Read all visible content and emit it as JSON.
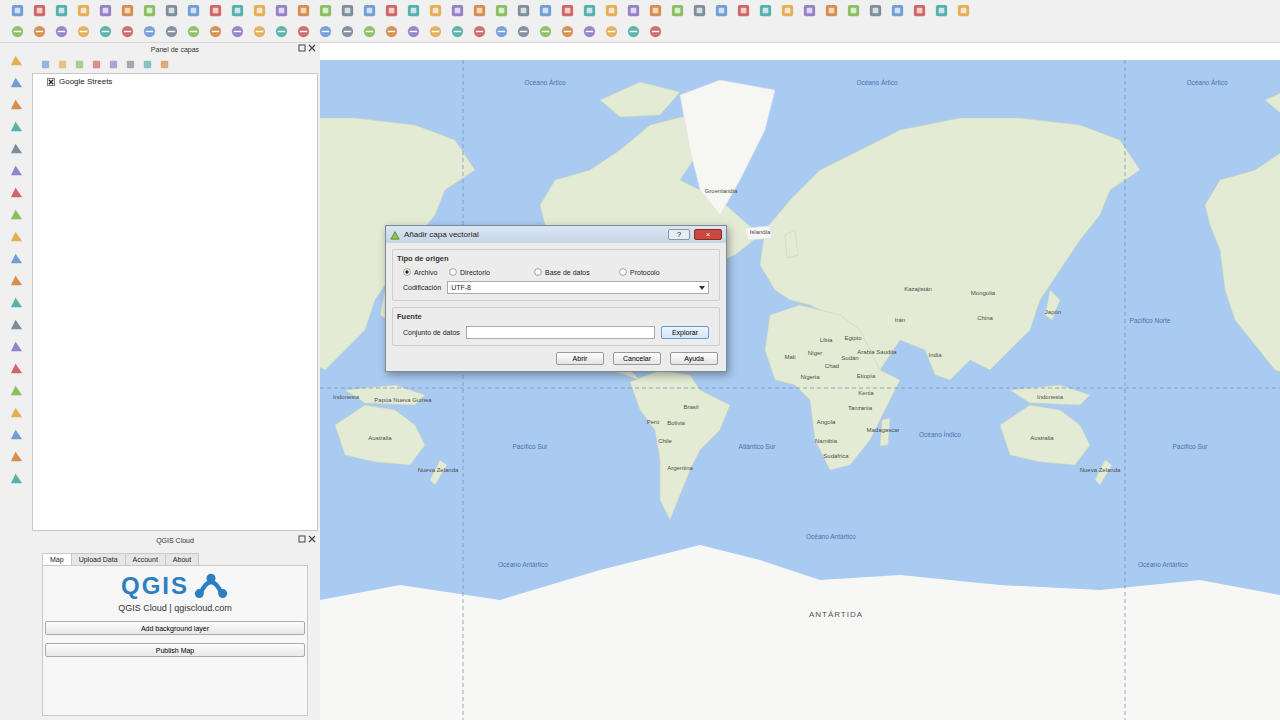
{
  "layers_panel": {
    "title": "Panel de capas",
    "layers": [
      {
        "name": "Google Streets",
        "checked": true
      }
    ]
  },
  "cloud_panel": {
    "title": "QGIS Cloud",
    "tabs": [
      {
        "label": "Map",
        "selected": true
      },
      {
        "label": "Upload Data",
        "selected": false
      },
      {
        "label": "Account",
        "selected": false
      },
      {
        "label": "About",
        "selected": false
      }
    ],
    "logo": {
      "text": "QGIS",
      "caption": "QGIS Cloud | qgiscloud.com"
    },
    "buttons": [
      "Add background layer",
      "Publish Map"
    ]
  },
  "map": {
    "labels": [
      {
        "text": "Océano Ártico",
        "kind": "ocean"
      },
      {
        "text": "Océano Ártico",
        "kind": "ocean"
      },
      {
        "text": "Océano Ártico",
        "kind": "ocean"
      },
      {
        "text": "Groenlandia",
        "kind": "country"
      },
      {
        "text": "Islandia",
        "kind": "country"
      },
      {
        "text": "Kazajistán",
        "kind": "country"
      },
      {
        "text": "Mongolia",
        "kind": "country"
      },
      {
        "text": "China",
        "kind": "country"
      },
      {
        "text": "Japón",
        "kind": "country"
      },
      {
        "text": "Pacífico Norte",
        "kind": "ocean"
      },
      {
        "text": "India",
        "kind": "country"
      },
      {
        "text": "Arabia Saudita",
        "kind": "country"
      },
      {
        "text": "Irán",
        "kind": "country"
      },
      {
        "text": "Libia",
        "kind": "country"
      },
      {
        "text": "Egipto",
        "kind": "country"
      },
      {
        "text": "Mali",
        "kind": "country"
      },
      {
        "text": "Níger",
        "kind": "country"
      },
      {
        "text": "Chad",
        "kind": "country"
      },
      {
        "text": "Sudán",
        "kind": "country"
      },
      {
        "text": "Nigeria",
        "kind": "country"
      },
      {
        "text": "Etiopía",
        "kind": "country"
      },
      {
        "text": "Kenia",
        "kind": "country"
      },
      {
        "text": "Tanzania",
        "kind": "country"
      },
      {
        "text": "Angola",
        "kind": "country"
      },
      {
        "text": "Namibia",
        "kind": "country"
      },
      {
        "text": "Sudáfrica",
        "kind": "country"
      },
      {
        "text": "Madagascar",
        "kind": "country"
      },
      {
        "text": "Océano Índico",
        "kind": "ocean"
      },
      {
        "text": "Indonesia",
        "kind": "country"
      },
      {
        "text": "Indonesia",
        "kind": "country"
      },
      {
        "text": "Papúa Nueva Guinea",
        "kind": "country"
      },
      {
        "text": "Australia",
        "kind": "country"
      },
      {
        "text": "Australia",
        "kind": "country"
      },
      {
        "text": "Nueva Zelanda",
        "kind": "country"
      },
      {
        "text": "Nueva Zelanda",
        "kind": "country"
      },
      {
        "text": "Pacífico Sur",
        "kind": "ocean"
      },
      {
        "text": "Pacífico Sur",
        "kind": "ocean"
      },
      {
        "text": "Atlántico Sur",
        "kind": "ocean"
      },
      {
        "text": "Brasil",
        "kind": "country"
      },
      {
        "text": "Perú",
        "kind": "country"
      },
      {
        "text": "Bolivia",
        "kind": "country"
      },
      {
        "text": "Chile",
        "kind": "country"
      },
      {
        "text": "Argentina",
        "kind": "country"
      },
      {
        "text": "Océano Antártico",
        "kind": "ocean"
      },
      {
        "text": "Océano Antártico",
        "kind": "ocean"
      },
      {
        "text": "Océano Antártico",
        "kind": "ocean"
      },
      {
        "text": "ANTÁRTIDA",
        "kind": "continent"
      }
    ]
  },
  "dialog": {
    "title": "Añadir capa vectorial",
    "help": "?",
    "close": "×",
    "source_type": {
      "title": "Tipo de origen",
      "options": [
        {
          "label": "Archivo",
          "selected": true
        },
        {
          "label": "Directorio",
          "selected": false
        },
        {
          "label": "Base de datos",
          "selected": false
        },
        {
          "label": "Protocolo",
          "selected": false
        }
      ]
    },
    "encoding": {
      "label": "Codificación",
      "value": "UTF-8"
    },
    "source": {
      "title": "Fuente",
      "field_label": "Conjunto de datos",
      "value": "",
      "browse": "Explorar"
    },
    "buttons": [
      "Abrir",
      "Cancelar",
      "Ayuda"
    ]
  }
}
